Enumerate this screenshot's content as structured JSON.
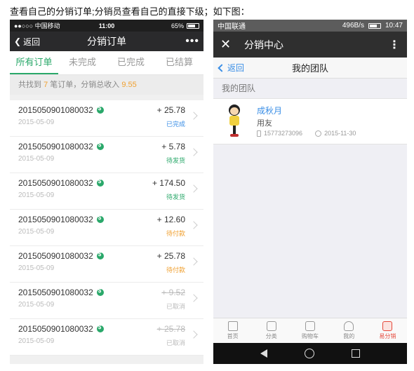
{
  "caption": "查看自己的分销订单;分销员查看自己的直接下级；如下图：",
  "left": {
    "status": {
      "carrier": "●●○○○ 中国移动",
      "time": "11:00",
      "battery_pct": "65%"
    },
    "nav": {
      "back_label": "返回",
      "title": "分销订单",
      "more": "•••"
    },
    "tabs": [
      "所有订单",
      "未完成",
      "已完成",
      "已结算"
    ],
    "summary": {
      "prefix": "共找到",
      "count": "7",
      "mid": "笔订单，分销总收入",
      "total": "9.55"
    },
    "orders": [
      {
        "num": "2015050901080032",
        "date": "2015-05-09",
        "amount": "+ 25.78",
        "status": "已完成"
      },
      {
        "num": "2015050901080032",
        "date": "2015-05-09",
        "amount": "+ 5.78",
        "status": "待发货"
      },
      {
        "num": "2015050901080032",
        "date": "2015-05-09",
        "amount": "+ 174.50",
        "status": "待发货"
      },
      {
        "num": "2015050901080032",
        "date": "2015-05-09",
        "amount": "+ 12.60",
        "status": "待付款"
      },
      {
        "num": "2015050901080032",
        "date": "2015-05-09",
        "amount": "+ 25.78",
        "status": "待付款"
      },
      {
        "num": "2015050901080032",
        "date": "2015-05-09",
        "amount": "+ 9.52",
        "status": "已取消"
      },
      {
        "num": "2015050901080032",
        "date": "2015-05-09",
        "amount": "+ 25.78",
        "status": "已取消"
      }
    ]
  },
  "right": {
    "status": {
      "carrier": "中国联通",
      "speed": "496B/s",
      "time": "10:47"
    },
    "header": {
      "title": "分销中心"
    },
    "subnav": {
      "back_label": "返回",
      "title": "我的团队"
    },
    "section_title": "我的团队",
    "member": {
      "name": "成秋月",
      "role": "用友",
      "phone": "15773273096",
      "date": "2015-11-30"
    },
    "tabbar": [
      {
        "label": "首页",
        "icon": "home-icon"
      },
      {
        "label": "分类",
        "icon": "category-icon"
      },
      {
        "label": "购物车",
        "icon": "cart-icon"
      },
      {
        "label": "我的",
        "icon": "user-icon"
      },
      {
        "label": "易分销",
        "icon": "share-icon"
      }
    ]
  }
}
